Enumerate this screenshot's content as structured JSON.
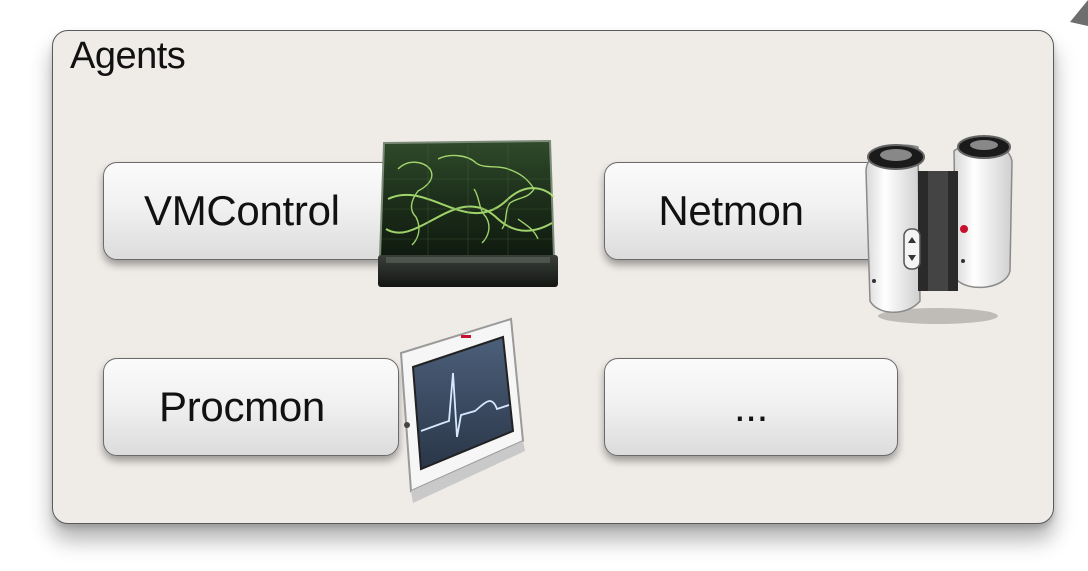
{
  "panel": {
    "title": "Agents"
  },
  "agents": [
    {
      "label": "VMControl",
      "icon": "world-map-display-icon"
    },
    {
      "label": "Netmon",
      "icon": "binoculars-icon"
    },
    {
      "label": "Procmon",
      "icon": "heart-monitor-icon"
    },
    {
      "label": "...",
      "icon": ""
    }
  ],
  "colors": {
    "panel_bg": "#efebe7",
    "panel_border": "#5a5a5a",
    "button_top": "#fbfbfb",
    "button_bottom": "#dcdcdc",
    "map_glow": "#b8f07a",
    "arrow": "#6e6e6e"
  }
}
